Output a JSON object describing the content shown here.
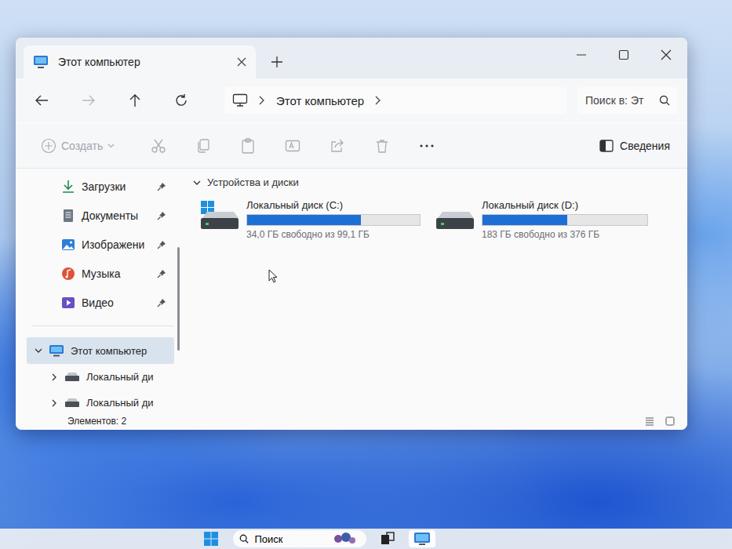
{
  "window": {
    "tab_title": "Этот компьютер"
  },
  "address": {
    "crumbs": [
      "Этот компьютер"
    ]
  },
  "search": {
    "placeholder": "Поиск в: Эт"
  },
  "toolbar": {
    "create": {
      "label": "Создать",
      "disabled": true
    },
    "actions": [
      {
        "kind": "cut",
        "disabled": true
      },
      {
        "kind": "copy",
        "disabled": true
      },
      {
        "kind": "paste",
        "disabled": true
      },
      {
        "kind": "rename",
        "disabled": true
      },
      {
        "kind": "share",
        "disabled": true
      },
      {
        "kind": "delete",
        "disabled": true
      }
    ],
    "details": "Сведения"
  },
  "sidebar": {
    "quick_access": [
      {
        "label": "Загрузки",
        "kind": "downloads",
        "pinned": true
      },
      {
        "label": "Документы",
        "kind": "documents",
        "pinned": true
      },
      {
        "label": "Изображени",
        "kind": "pictures",
        "pinned": true
      },
      {
        "label": "Музыка",
        "kind": "music",
        "pinned": true
      },
      {
        "label": "Видео",
        "kind": "video",
        "pinned": true
      }
    ],
    "tree": [
      {
        "label": "Этот компьютер",
        "kind": "pc",
        "selected": true,
        "expanded": true
      },
      {
        "label": "Локальный ди",
        "kind": "drive",
        "selected": false,
        "expanded": false
      },
      {
        "label": "Локальный ди",
        "kind": "drive",
        "selected": false,
        "expanded": false
      }
    ]
  },
  "section": {
    "title": "Устройства и диски",
    "expanded": true
  },
  "drives": [
    {
      "name": "Локальный диск (C:)",
      "system": true,
      "level": 0.657,
      "free": "34,0 ГБ свободно из 99,1 ГБ"
    },
    {
      "name": "Локальный диск (D:)",
      "system": false,
      "level": 0.513,
      "free": "183 ГБ свободно из 376 ГБ"
    }
  ],
  "status_bar": {
    "count": "Элементов: 2"
  },
  "taskbar": {
    "search": "Поиск"
  }
}
